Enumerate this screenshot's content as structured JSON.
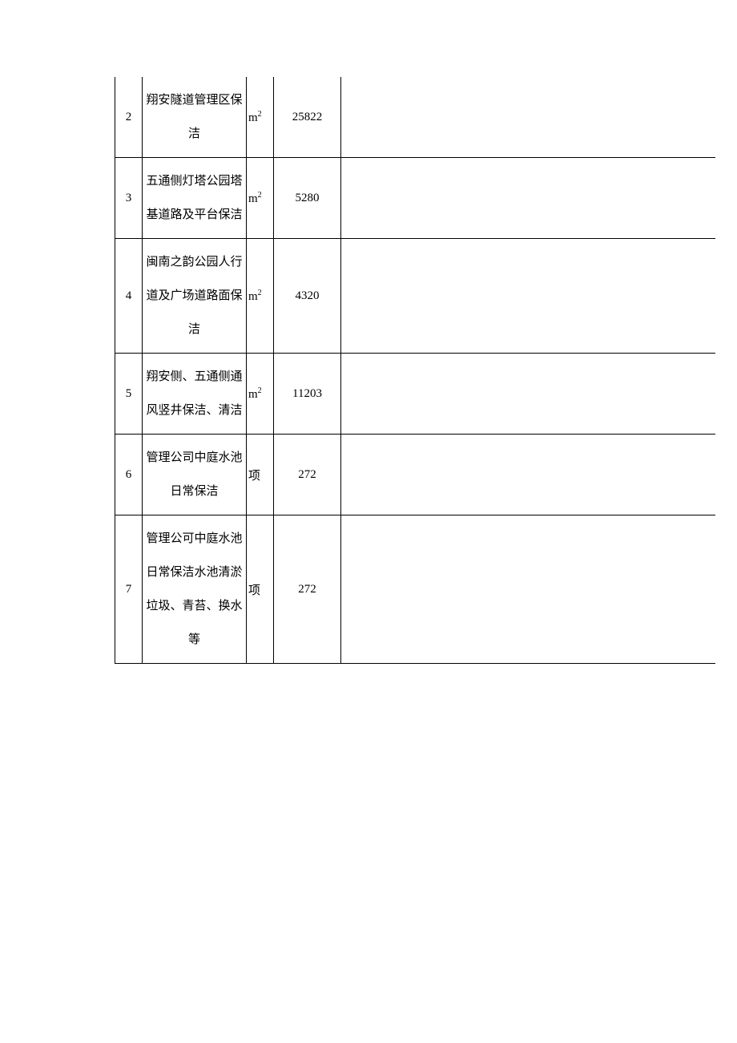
{
  "unit_m2_base": "m",
  "unit_m2_sup": "2",
  "rows": [
    {
      "idx": "2",
      "name": "翔安隧道管理区保洁",
      "unit_type": "m2",
      "qty": "25822"
    },
    {
      "idx": "3",
      "name": "五通侧灯塔公园塔基道路及平台保洁",
      "unit_type": "m2",
      "qty": "5280"
    },
    {
      "idx": "4",
      "name": "闽南之韵公园人行道及广场道路面保洁",
      "unit_type": "m2",
      "qty": "4320"
    },
    {
      "idx": "5",
      "name": "翔安侧、五通侧通风竖井保洁、清洁",
      "unit_type": "m2",
      "qty": "11203"
    },
    {
      "idx": "6",
      "name": "管理公司中庭水池日常保洁",
      "unit_type": "text",
      "unit": "项",
      "qty": "272"
    },
    {
      "idx": "7",
      "name": "管理公可中庭水池日常保洁水池清淤垃圾、青苔、换水等",
      "unit_type": "text",
      "unit": "项",
      "qty": "272"
    }
  ]
}
